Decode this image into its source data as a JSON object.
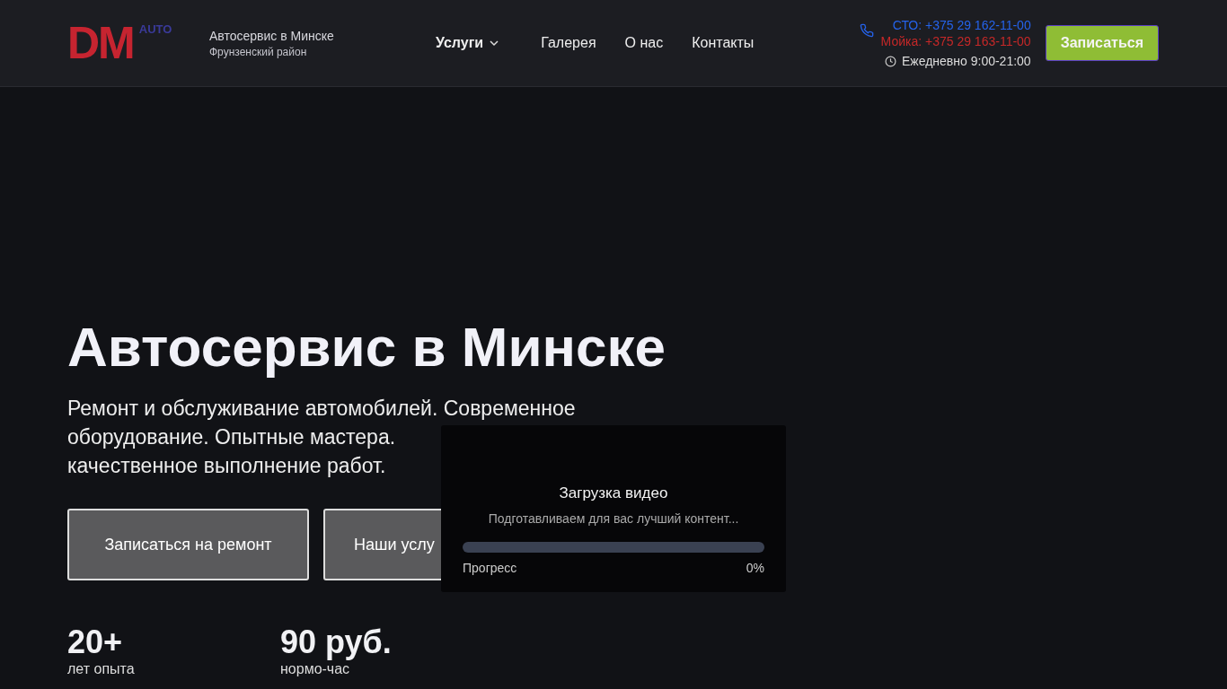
{
  "header": {
    "logo": {
      "mark": "DM",
      "tag": "AUTO"
    },
    "title": "Автосервис в Минске",
    "subtitle": "Фрунзенский район",
    "nav": [
      {
        "label": "Услуги",
        "kind": "dropdown"
      },
      {
        "label": "Галерея",
        "kind": "link"
      },
      {
        "label": "О нас",
        "kind": "link"
      },
      {
        "label": "Контакты",
        "kind": "link"
      }
    ],
    "phones": [
      {
        "text": "СТО: +375 29 162-11-00",
        "color": "#2563eb"
      },
      {
        "text": "Мойка: +375 29 163-11-00",
        "color": "#c62828"
      }
    ],
    "hours": "Ежедневно 9:00-21:00",
    "cta": "Записаться"
  },
  "hero": {
    "title": "Автосервис в Минске",
    "lines": [
      "Ремонт и обслуживание автомобилей. Современное",
      "оборудование. Опытные мастера.",
      "качественное выполнение работ."
    ],
    "buttons": [
      "Записаться на ремонт",
      "Наши услу"
    ],
    "stats": [
      {
        "value": "20+",
        "label": "лет опыта"
      },
      {
        "value": "90 руб.",
        "label": "нормо-час"
      }
    ]
  },
  "loader": {
    "title": "Загрузка видео",
    "text": "Подготавливаем для вас лучший контент...",
    "progress_label": "Прогресс",
    "reading": "0%",
    "level": 0
  }
}
